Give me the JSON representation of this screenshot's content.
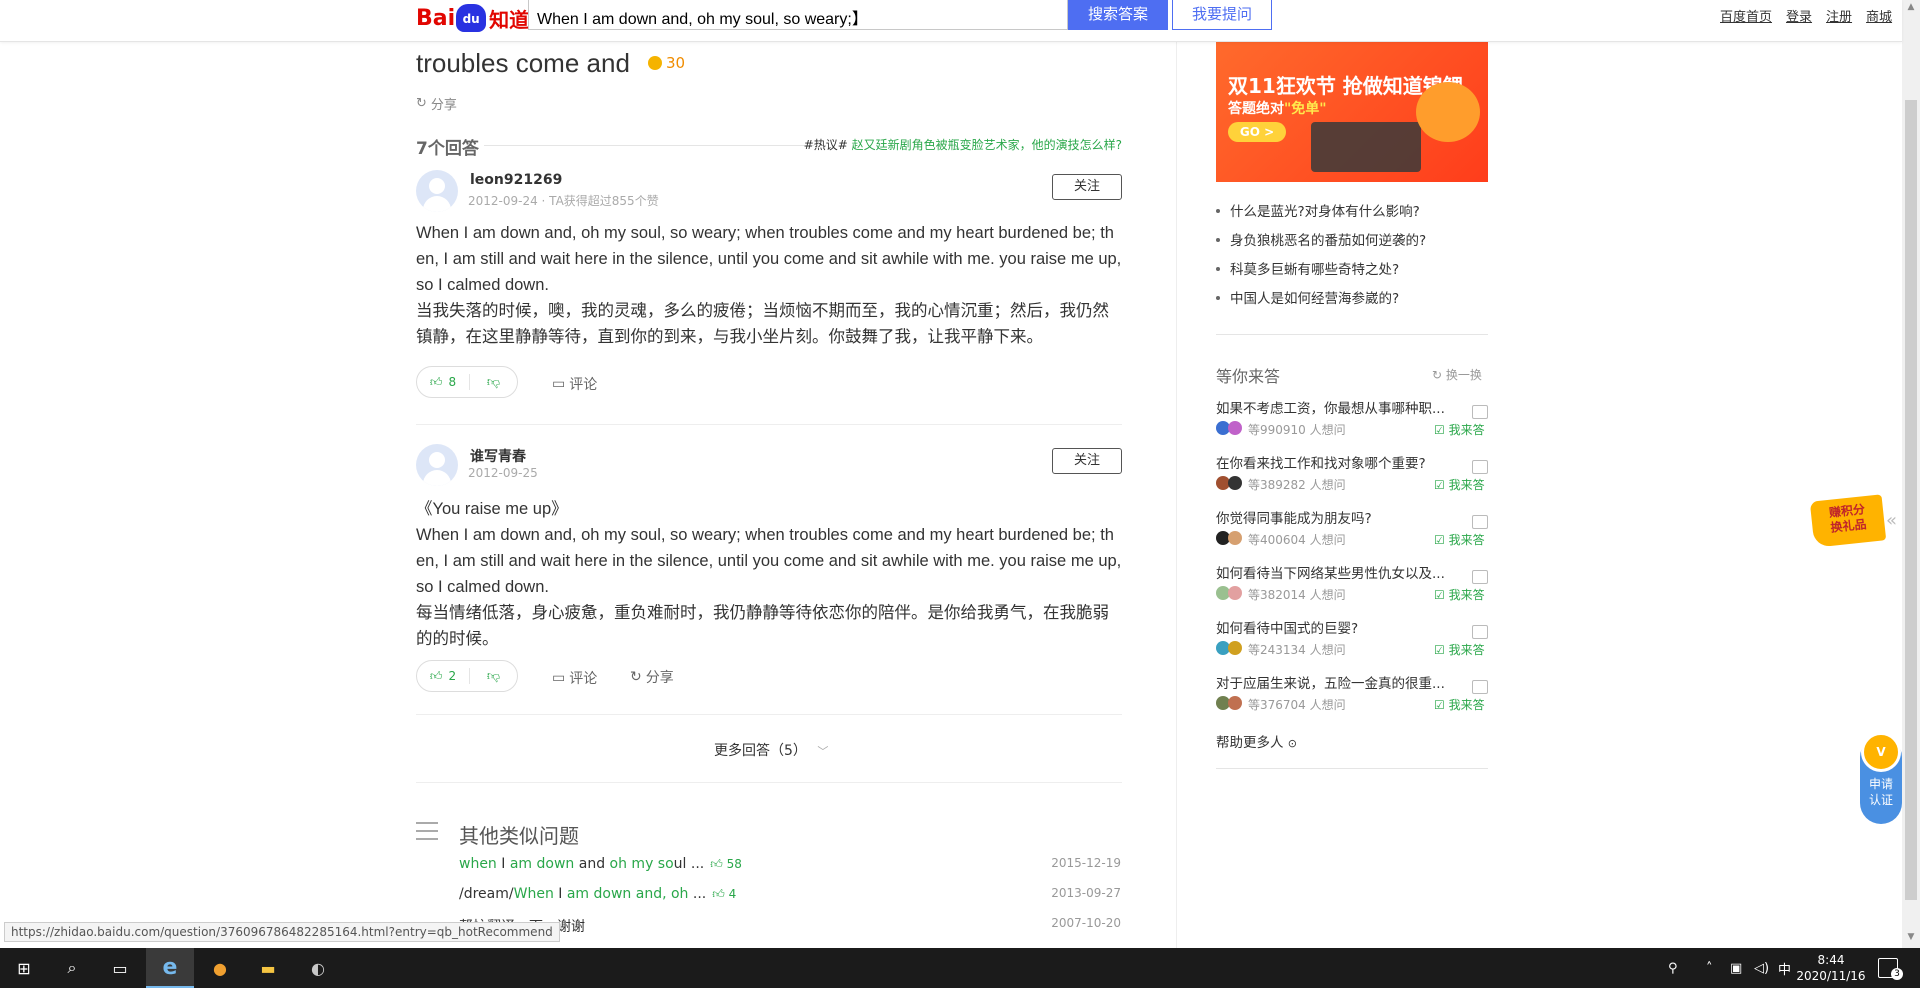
{
  "header": {
    "logo_bai": "Bai",
    "logo_du": "du",
    "logo_zhidao": "知道",
    "search_value": "When I am down and, oh my soul, so weary;",
    "search_button": "搜索答案",
    "ask_button": "我要提问",
    "links": [
      "百度首页",
      "登录",
      "注册",
      "商城"
    ]
  },
  "question": {
    "title": "troubles come and",
    "reward": "30",
    "share": "分享"
  },
  "answers_header": {
    "count": "7个回答",
    "hot_tag": "#热议#",
    "hot_link": "赵又廷新剧角色被瓶变脸艺术家，他的演技怎么样?"
  },
  "answers": [
    {
      "user": "leon921269",
      "meta": "2012-09-24 · TA获得超过855个赞",
      "follow": "关注",
      "paragraphs": [
        "When I am down and, oh my soul, so weary; when troubles come and my heart burdened be; then, I am still and wait here in the silence, until you come and sit awhile with me. you raise me up, so I calmed down.",
        "当我失落的时候，噢，我的灵魂，多么的疲倦；当烦恼不期而至，我的心情沉重；然后，我仍然镇静，在这里静静等待，直到你的到来，与我小坐片刻。你鼓舞了我，让我平静下来。"
      ],
      "likes": "8",
      "comment": "评论"
    },
    {
      "user": "谁写青春",
      "meta": "2012-09-25",
      "follow": "关注",
      "paragraphs": [
        "《You raise me up》",
        "When I am down and, oh my soul, so weary; when troubles come and my heart burdened be; then, I am still and wait here in the silence, until you come and sit awhile with me. you raise me up, so I calmed down.",
        "每当情绪低落，身心疲惫，重负难耐时，我仍静静等待依恋你的陪伴。是你给我勇气，在我脆弱的的时候。"
      ],
      "likes": "2",
      "comment": "评论",
      "share": "分享"
    }
  ],
  "more_answers": "更多回答（5）",
  "similar": {
    "title": "其他类似问题",
    "items": [
      {
        "parts": [
          [
            "when",
            true
          ],
          [
            " I ",
            false
          ],
          [
            "am down",
            true
          ],
          [
            " and ",
            false
          ],
          [
            "oh my so",
            true
          ],
          [
            "ul ...",
            false
          ]
        ],
        "likes": "58",
        "date": "2015-12-19"
      },
      {
        "parts": [
          [
            "/dream/",
            false
          ],
          [
            "When",
            true
          ],
          [
            " I ",
            false
          ],
          [
            "am down and, oh",
            true
          ],
          [
            " ...",
            false
          ]
        ],
        "likes": "4",
        "date": "2013-09-27"
      },
      {
        "parts": [
          [
            "帮忙翻译一下，谢谢",
            false
          ]
        ],
        "likes": "",
        "date": "2007-10-20"
      }
    ]
  },
  "sidebar": {
    "banner_title": "双11狂欢节 抢做知道锦鲤",
    "banner_sub_a": "答题绝对",
    "banner_sub_b": "\"免单\"",
    "banner_go": "GO >",
    "hot_questions": [
      "什么是蓝光?对身体有什么影响?",
      "身负狼桃恶名的番茄如何逆袭的?",
      "科莫多巨蜥有哪些奇特之处?",
      "中国人是如何经营海参崴的?"
    ],
    "wait_title": "等你来答",
    "refresh": "换一换",
    "wait_items": [
      {
        "q": "如果不考虑工资，你最想从事哪种职...",
        "count": "等990910 人想问",
        "answer": "我来答"
      },
      {
        "q": "在你看来找工作和找对象哪个重要?",
        "count": "等389282 人想问",
        "answer": "我来答"
      },
      {
        "q": "你觉得同事能成为朋友吗?",
        "count": "等400604 人想问",
        "answer": "我来答"
      },
      {
        "q": "如何看待当下网络某些男性仇女以及...",
        "count": "等382014 人想问",
        "answer": "我来答"
      },
      {
        "q": "如何看待中国式的巨婴?",
        "count": "等243134 人想问",
        "answer": "我来答"
      },
      {
        "q": "对于应届生来说，五险一金真的很重...",
        "count": "等376704 人想问",
        "answer": "我来答"
      }
    ],
    "help_more": "帮助更多人"
  },
  "floating": {
    "gift_line1": "赚积分",
    "gift_line2": "换礼品",
    "cert_line1": "申请",
    "cert_line2": "认证"
  },
  "status_url": "https://zhidao.baidu.com/question/376096786482285164.html?entry=qb_hotRecommend",
  "taskbar": {
    "time": "8:44",
    "date": "2020/11/16",
    "ime": "中",
    "notifications": "3"
  },
  "colors": {
    "accent_blue": "#4e6ef2",
    "green": "#2aa74a",
    "baidu_red": "#e10601"
  }
}
